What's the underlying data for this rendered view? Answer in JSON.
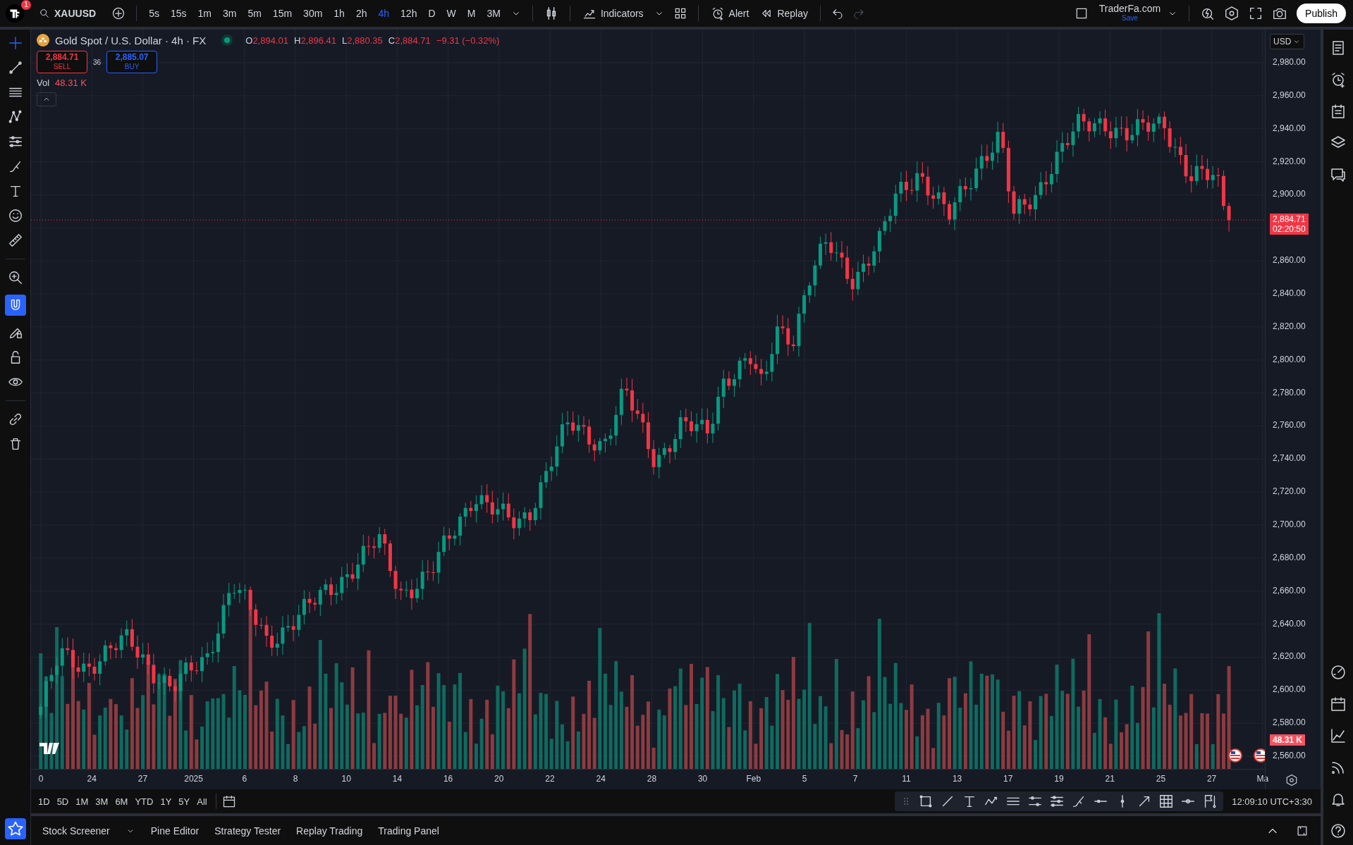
{
  "top_bar": {
    "notification_count": "1",
    "symbol": "XAUUSD",
    "intervals": [
      {
        "label": "5s",
        "selected": false
      },
      {
        "label": "15s",
        "selected": false
      },
      {
        "label": "1m",
        "selected": false
      },
      {
        "label": "3m",
        "selected": false
      },
      {
        "label": "5m",
        "selected": false
      },
      {
        "label": "15m",
        "selected": false
      },
      {
        "label": "30m",
        "selected": false
      },
      {
        "label": "1h",
        "selected": false
      },
      {
        "label": "2h",
        "selected": false
      },
      {
        "label": "4h",
        "selected": true
      },
      {
        "label": "12h",
        "selected": false
      },
      {
        "label": "D",
        "selected": false
      },
      {
        "label": "W",
        "selected": false
      },
      {
        "label": "M",
        "selected": false
      },
      {
        "label": "3M",
        "selected": false
      }
    ],
    "indicators_label": "Indicators",
    "alert_label": "Alert",
    "replay_label": "Replay",
    "layout_name": "TraderFa.com",
    "save_label": "Save",
    "publish_label": "Publish"
  },
  "legend": {
    "title": "Gold Spot / U.S. Dollar · 4h · FX",
    "ohlc": [
      {
        "key": "O",
        "value": "2,894.01"
      },
      {
        "key": "H",
        "value": "2,896.41"
      },
      {
        "key": "L",
        "value": "2,880.35"
      },
      {
        "key": "C",
        "value": "2,884.71"
      }
    ],
    "change": "−9.31 (−0.32%)",
    "sell_price": "2,884.71",
    "sell_label": "SELL",
    "spread": "36",
    "buy_price": "2,885.07",
    "buy_label": "BUY",
    "volume_label": "Vol",
    "volume_value": "48.31 K"
  },
  "price_axis": {
    "currency": "USD",
    "labels_above_tag": [
      "2,980.00",
      "2,960.00",
      "2,940.00",
      "2,920.00",
      "2,900.00"
    ],
    "labels_below_tag": [
      "2,860.00",
      "2,840.00",
      "2,820.00",
      "2,800.00",
      "2,780.00",
      "2,760.00",
      "2,740.00",
      "2,720.00",
      "2,700.00",
      "2,680.00",
      "2,660.00",
      "2,640.00",
      "2,620.00",
      "2,600.00",
      "2,580.00",
      "2,560.00"
    ],
    "last_price": "2,884.71",
    "countdown": "02:20:50",
    "volume_tag": "48.31 K"
  },
  "time_axis": {
    "labels": [
      "0",
      "24",
      "27",
      "2025",
      "6",
      "8",
      "10",
      "14",
      "16",
      "20",
      "22",
      "24",
      "28",
      "30",
      "Feb",
      "5",
      "7",
      "11",
      "13",
      "17",
      "19",
      "21",
      "25",
      "27",
      "Ma"
    ]
  },
  "ranges": [
    "1D",
    "5D",
    "1M",
    "3M",
    "6M",
    "YTD",
    "1Y",
    "5Y",
    "All"
  ],
  "clock": "12:09:10 UTC+3:30",
  "left_tools": [
    {
      "kind": "crosshair",
      "active": true
    },
    {
      "kind": "trend",
      "active": false
    },
    {
      "kind": "hlines",
      "active": false
    },
    {
      "kind": "pattern",
      "active": false
    },
    {
      "kind": "forecast",
      "active": false
    },
    {
      "kind": "brush",
      "active": false
    },
    {
      "kind": "text",
      "active": false
    },
    {
      "kind": "smiley",
      "active": false
    },
    {
      "kind": "ruler",
      "active": false
    },
    {
      "kind": "zoom",
      "active": false
    },
    {
      "kind": "magnet",
      "active": true
    },
    {
      "kind": "pencil",
      "active": false
    },
    {
      "kind": "lock",
      "active": false
    },
    {
      "kind": "eye",
      "active": false
    },
    {
      "kind": "link",
      "active": false
    },
    {
      "kind": "trash",
      "active": false
    }
  ],
  "bottom_tabs": [
    "Stock Screener",
    "Pine Editor",
    "Strategy Tester",
    "Replay Trading",
    "Trading Panel"
  ]
}
